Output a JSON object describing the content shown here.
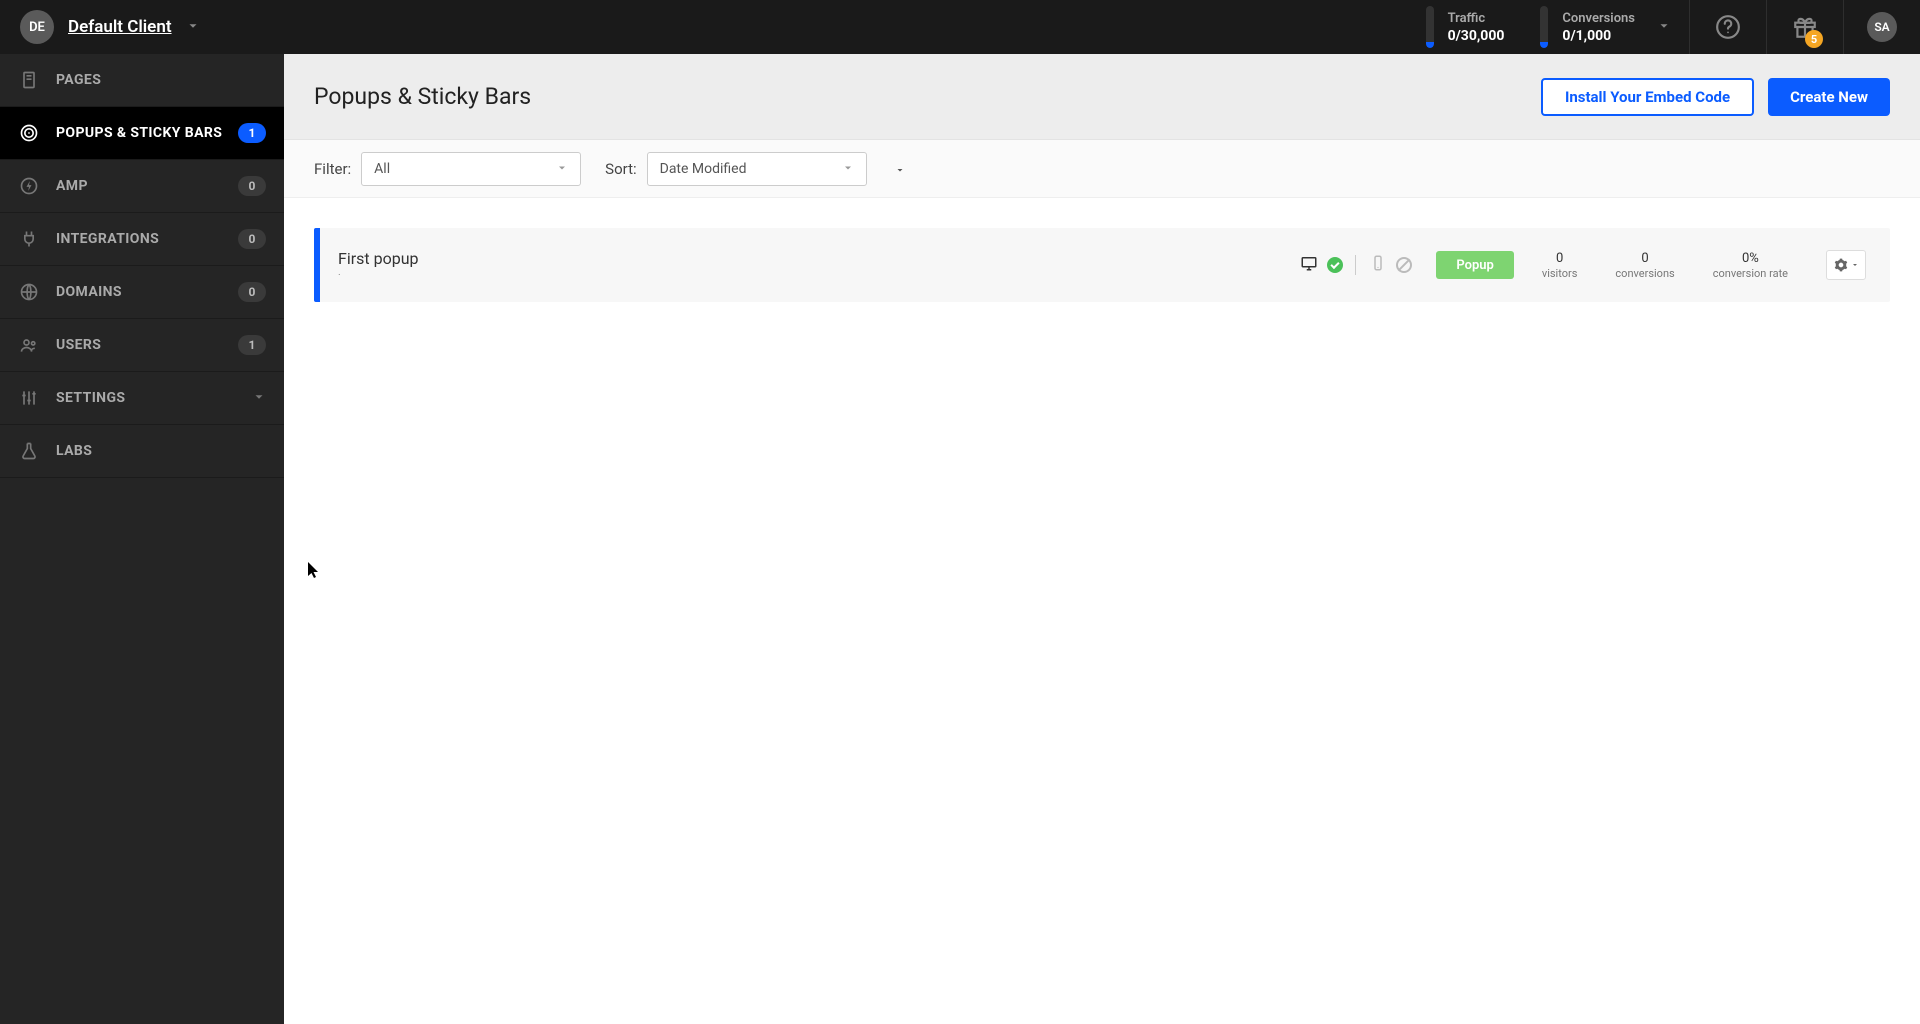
{
  "header": {
    "client_initials": "DE",
    "client_name": "Default Client",
    "traffic_label": "Traffic",
    "traffic_value": "0/30,000",
    "conversions_label": "Conversions",
    "conversions_value": "0/1,000",
    "gift_badge": "5",
    "user_initials": "SA"
  },
  "sidebar": {
    "items": [
      {
        "label": "PAGES",
        "badge": "",
        "badge_blue": false
      },
      {
        "label": "POPUPS & STICKY BARS",
        "badge": "1",
        "badge_blue": true
      },
      {
        "label": "AMP",
        "badge": "0",
        "badge_blue": false
      },
      {
        "label": "INTEGRATIONS",
        "badge": "0",
        "badge_blue": false
      },
      {
        "label": "DOMAINS",
        "badge": "0",
        "badge_blue": false
      },
      {
        "label": "USERS",
        "badge": "1",
        "badge_blue": false
      },
      {
        "label": "SETTINGS",
        "badge": "",
        "badge_blue": false
      },
      {
        "label": "LABS",
        "badge": "",
        "badge_blue": false
      }
    ]
  },
  "main": {
    "title": "Popups & Sticky Bars",
    "embed_button": "Install Your Embed Code",
    "create_button": "Create New",
    "filter_label": "Filter:",
    "filter_value": "All",
    "sort_label": "Sort:",
    "sort_value": "Date Modified"
  },
  "rows": [
    {
      "name": "First popup",
      "sub": "·",
      "type": "Popup",
      "m1_value": "0",
      "m1_label": "visitors",
      "m2_value": "0",
      "m2_label": "conversions",
      "m3_value": "0%",
      "m3_label": "conversion rate"
    }
  ]
}
